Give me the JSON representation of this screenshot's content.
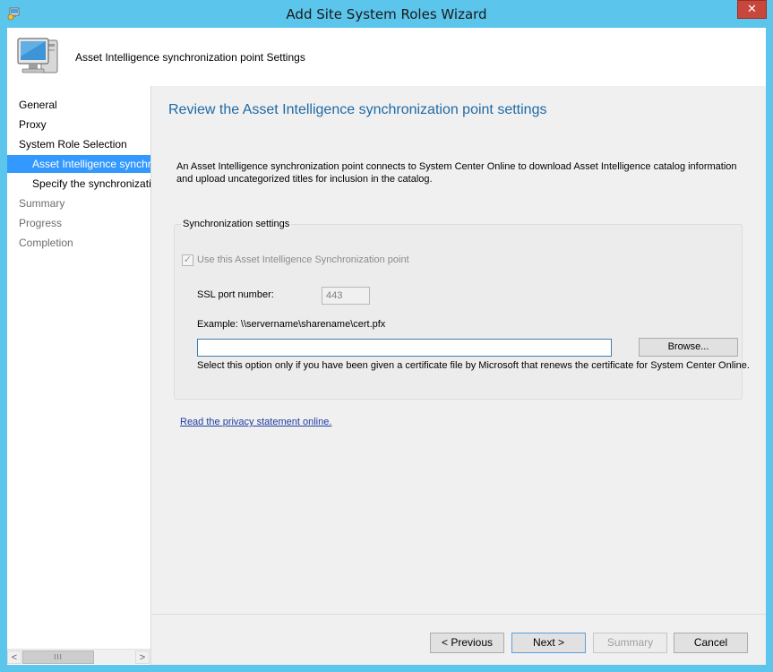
{
  "window": {
    "title": "Add Site System Roles Wizard",
    "close_glyph": "✕",
    "app_icon": "wizard-app-icon"
  },
  "banner": {
    "icon": "computer-monitor-icon",
    "text": "Asset Intelligence synchronization point Settings"
  },
  "nav": {
    "items": [
      {
        "label": "General",
        "state": "normal"
      },
      {
        "label": "Proxy",
        "state": "normal"
      },
      {
        "label": "System Role Selection",
        "state": "normal"
      },
      {
        "label": "Asset Intelligence synchronization point",
        "state": "selected"
      },
      {
        "label": "Specify the synchronization schedule",
        "state": "normal"
      },
      {
        "label": "Summary",
        "state": "disabled"
      },
      {
        "label": "Progress",
        "state": "disabled"
      },
      {
        "label": "Completion",
        "state": "disabled"
      }
    ],
    "scroll_left": "<",
    "scroll_right": ">",
    "scroll_thumb": "III"
  },
  "main": {
    "heading": "Review the Asset Intelligence synchronization point settings",
    "description": "An Asset Intelligence synchronization point connects to System Center Online to download Asset Intelligence catalog information and upload uncategorized titles for inclusion in the catalog.",
    "group_title": "Synchronization settings",
    "use_point_label": "Use this Asset Intelligence Synchronization point",
    "use_point_checked": true,
    "ssl_label": "SSL port number:",
    "ssl_port": "443",
    "example_label": "Example: \\\\servername\\sharename\\cert.pfx",
    "cert_path_value": "",
    "browse_label": "Browse...",
    "hint": "Select this option only if you have been given a certificate file by Microsoft that renews the certificate for System Center Online.",
    "privacy_link": "Read the privacy statement online."
  },
  "footer": {
    "previous": "< Previous",
    "next": "Next >",
    "summary": "Summary",
    "cancel": "Cancel"
  },
  "colors": {
    "title_bar": "#5bc5ec",
    "heading": "#1e6aa6",
    "nav_selected": "#3399ff",
    "link": "#1d3da0"
  }
}
